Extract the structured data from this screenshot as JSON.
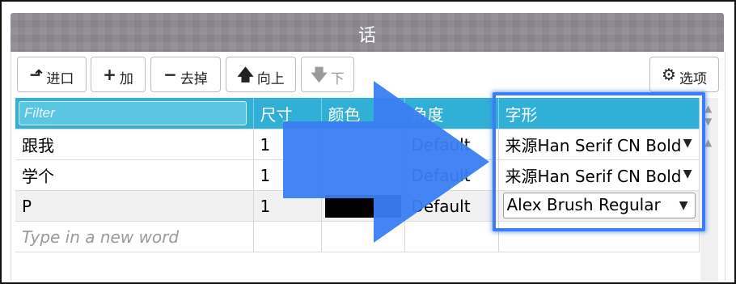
{
  "window": {
    "title": "话"
  },
  "toolbar": {
    "import_label": "进口",
    "add_label": "加",
    "remove_label": "去掉",
    "up_label": "向上",
    "down_label": "下",
    "options_label": "选项"
  },
  "icons": {
    "import": "import-icon",
    "add": "plus-icon",
    "remove": "minus-icon",
    "up": "arrow-up-icon",
    "down": "arrow-down-icon",
    "options": "gear-icon"
  },
  "table": {
    "filter_placeholder": "Filter",
    "columns": [
      "尺寸",
      "颜色",
      "角度",
      "字形"
    ],
    "rows": [
      {
        "word": "跟我",
        "size": "1",
        "color": "",
        "angle": "Default",
        "font": "来源Han Serif CN Bold"
      },
      {
        "word": "学个",
        "size": "1",
        "color": "",
        "angle": "Default",
        "font": "来源Han Serif CN Bold"
      },
      {
        "word": "P",
        "size": "1",
        "color": "#000000",
        "angle": "Default",
        "font": "Alex Brush Regular"
      }
    ],
    "new_word_placeholder": "Type in a new word"
  },
  "colors": {
    "header": "#30b0d6",
    "highlight": "#3b7df2",
    "titlebar": "#8e8a94"
  }
}
